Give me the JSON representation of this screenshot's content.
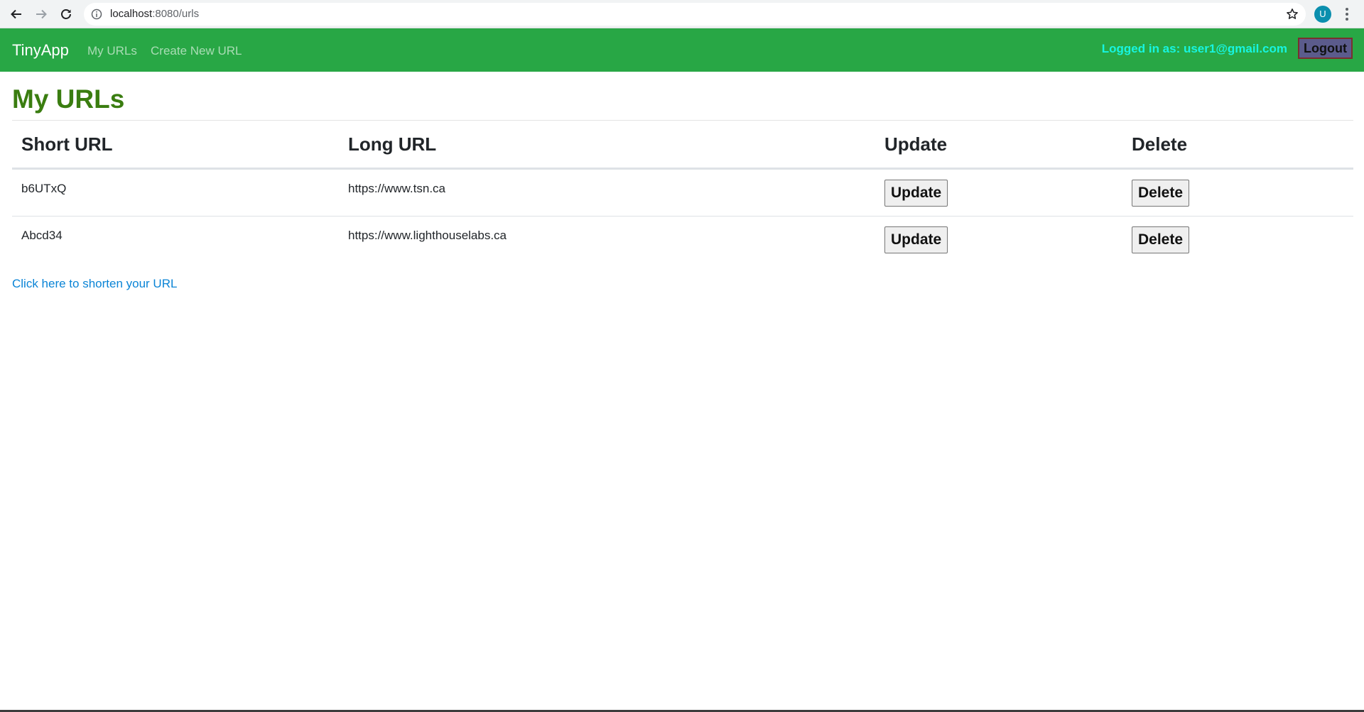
{
  "browser": {
    "url_host": "localhost",
    "url_path": ":8080/urls",
    "profile_initial": "U"
  },
  "navbar": {
    "brand": "TinyApp",
    "links": [
      "My URLs",
      "Create New URL"
    ],
    "logged_in_text": "Logged in as: user1@gmail.com",
    "logout_label": "Logout",
    "colors": {
      "bar": "#28a745",
      "logged_in": "#17f5e0"
    }
  },
  "main": {
    "title": "My URLs",
    "columns": [
      "Short URL",
      "Long URL",
      "Update",
      "Delete"
    ],
    "rows": [
      {
        "short_url": "b6UTxQ",
        "long_url": "https://www.tsn.ca",
        "update_label": "Update",
        "delete_label": "Delete"
      },
      {
        "short_url": "Abcd34",
        "long_url": "https://www.lighthouselabs.ca",
        "update_label": "Update",
        "delete_label": "Delete"
      }
    ],
    "shorten_link": "Click here to shorten your URL"
  },
  "icons": [
    "back-arrow-icon",
    "forward-arrow-icon",
    "reload-icon",
    "info-icon",
    "star-icon",
    "menu-dots-icon"
  ]
}
